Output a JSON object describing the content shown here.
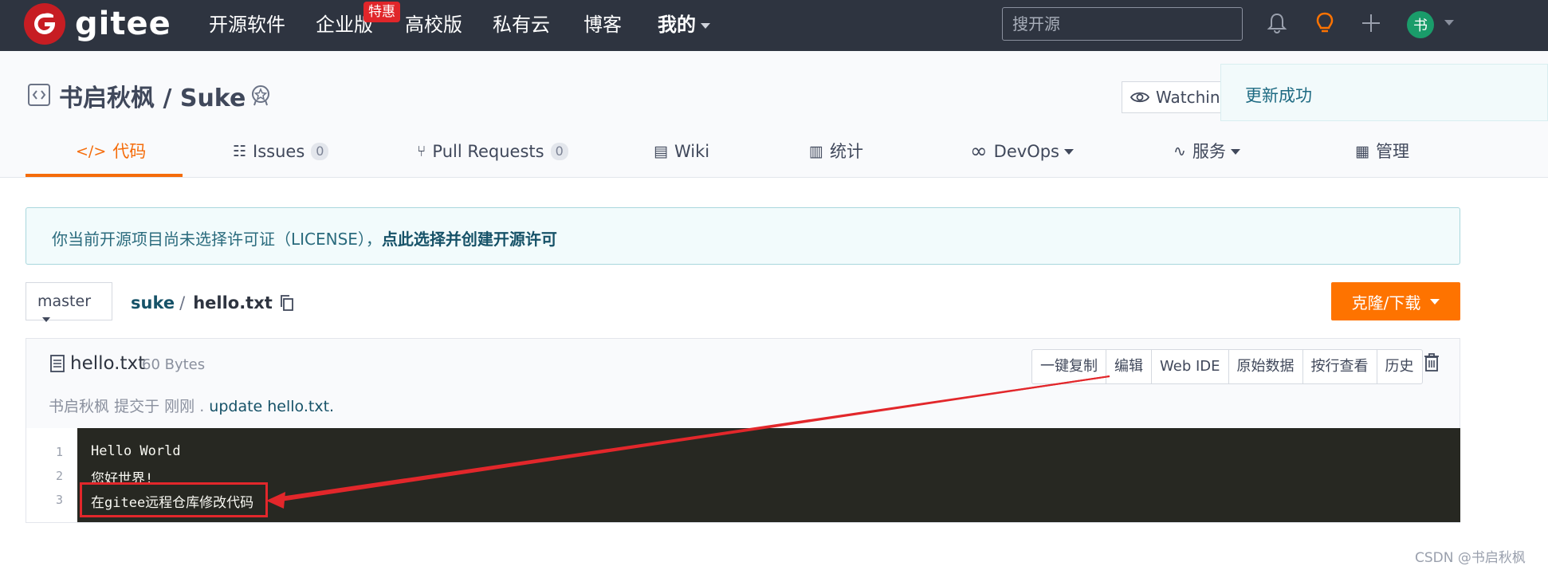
{
  "nav": {
    "brand": "gitee",
    "items": [
      "开源软件",
      "企业版",
      "高校版",
      "私有云",
      "博客",
      "我的"
    ],
    "promo_badge": "特惠",
    "search_placeholder": "搜开源",
    "avatar_initial": "书"
  },
  "project": {
    "title": "书启秋枫 / Suke",
    "watch_label": "Watching",
    "toast_message": "更新成功",
    "tabs": [
      {
        "label": "代码",
        "active": true
      },
      {
        "label": "Issues",
        "count": "0"
      },
      {
        "label": "Pull Requests",
        "count": "0"
      },
      {
        "label": "Wiki"
      },
      {
        "label": "统计"
      },
      {
        "label": "DevOps"
      },
      {
        "label": "服务"
      },
      {
        "label": "管理"
      }
    ]
  },
  "license_banner": {
    "text": "你当前开源项目尚未选择许可证（LICENSE），",
    "link": "点此选择并创建开源许可"
  },
  "branch": {
    "name": "master",
    "breadcrumb_repo": "suke",
    "breadcrumb_sep": "/",
    "breadcrumb_file": "hello.txt",
    "clone_label": "克隆/下载"
  },
  "file": {
    "name": "hello.txt",
    "size": "60 Bytes",
    "actions": [
      "一键复制",
      "编辑",
      "Web IDE",
      "原始数据",
      "按行查看",
      "历史"
    ],
    "commit_author": "书启秋枫",
    "commit_verb": "提交于",
    "commit_time": "刚刚",
    "commit_dot": ".",
    "commit_message": "update hello.txt."
  },
  "code": {
    "lines": [
      {
        "number": "1",
        "text": "Hello World"
      },
      {
        "number": "2",
        "text": "您好世界!"
      },
      {
        "number": "3",
        "text": "在gitee远程仓库修改代码"
      }
    ]
  },
  "watermark": "CSDN @书启秋枫",
  "colors": {
    "nav_bg": "#2e3440",
    "accent_orange": "#fe7300",
    "tab_active": "#f56c0a",
    "code_bg": "#272822",
    "annotation_red": "#e2272b"
  }
}
